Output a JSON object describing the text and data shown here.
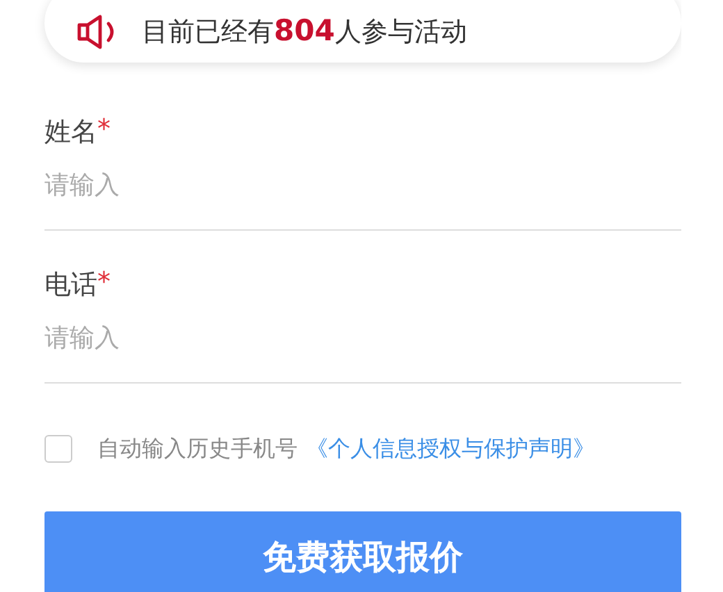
{
  "banner": {
    "text": "目前已经有**804**人参与活动"
  },
  "fields": [
    {
      "label": "姓名",
      "required_mark": "*",
      "placeholder": "请输入"
    },
    {
      "label": "电话",
      "required_mark": "*",
      "placeholder": "请输入"
    }
  ],
  "consent": {
    "checked": false,
    "text": "自动输入历史手机号",
    "link": "《个人信息授权与保护声明》"
  },
  "submit_button": "免费获取报价"
}
